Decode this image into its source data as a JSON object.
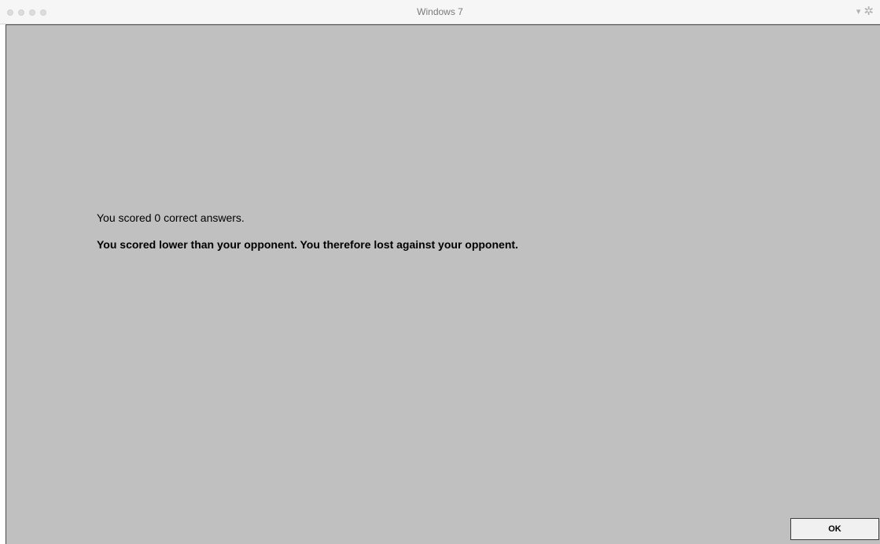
{
  "window": {
    "title": "Windows 7",
    "dropdown_icon": "triangle-down-icon",
    "settings_icon": "gear-icon"
  },
  "main": {
    "score_text": "You scored 0 correct answers.",
    "result_text": "You scored lower than your opponent. You therefore lost against your opponent."
  },
  "footer": {
    "ok_label": "OK"
  },
  "colors": {
    "background": "#c0c0c0",
    "button": "#f0f0f0"
  }
}
